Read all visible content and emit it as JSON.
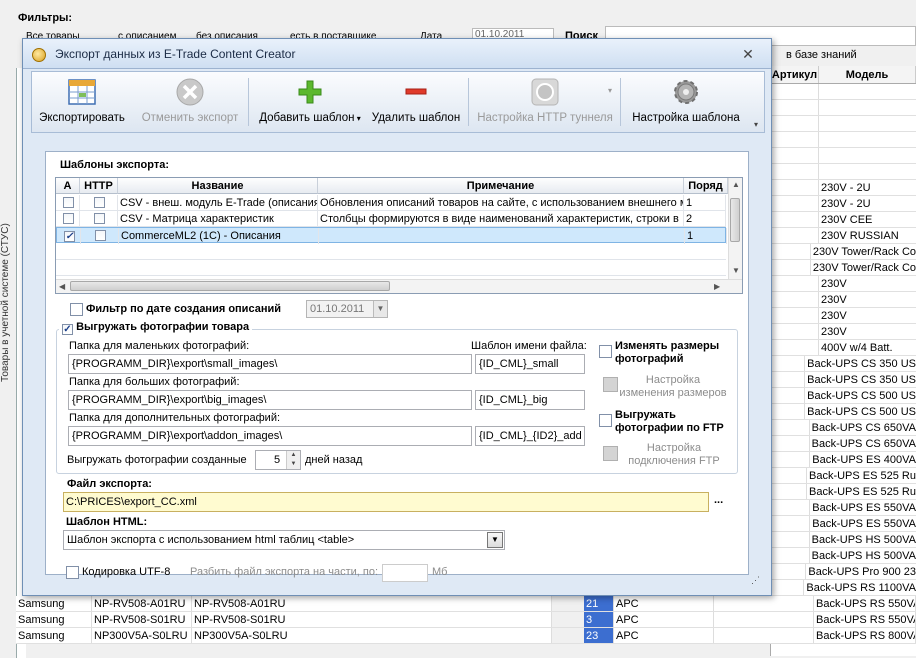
{
  "bg": {
    "filters_label": "Фильтры:",
    "filter_opt1": "Все товары",
    "filter_opt2": "с описанием",
    "filter_opt3": "без описания",
    "filter_opt4": "есть в поставщике",
    "date_label": "Дата",
    "date_value": "01.10.2011",
    "search_label": "Поиск",
    "kb_label": "в базе знаний",
    "vertical_label": "Товары в учетной системе (СТУС)",
    "right_headers": [
      "Артикул",
      "Модель"
    ],
    "right_rows": [
      "",
      "",
      "",
      "",
      "",
      "",
      "230V - 2U",
      "230V - 2U",
      "230V CEE",
      "230V RUSSIAN",
      "230V Tower/Rack Co",
      "230V Tower/Rack Co",
      "230V",
      "230V",
      "230V",
      "230V",
      "400V w/4 Batt.",
      "Back-UPS CS 350 US",
      "Back-UPS CS 350 US",
      "Back-UPS CS 500 US",
      "Back-UPS CS 500 US",
      "Back-UPS CS 650VA",
      "Back-UPS CS 650VA",
      "Back-UPS ES 400VA",
      "Back-UPS ES 525 Ru",
      "Back-UPS ES 525 Ru",
      "Back-UPS ES 550VA",
      "Back-UPS ES 550VA",
      "Back-UPS HS 500VA",
      "Back-UPS HS 500VA",
      "Back-UPS Pro 900 23",
      "Back-UPS RS 1100VA",
      "Back-UPS RS 1100VA",
      "Back-UPS RS 550VA",
      "Back-UPS RS 550VA",
      "Back-UPS RS 800VA"
    ],
    "bottom_rows": [
      {
        "brand": "Samsung",
        "code": "NP-RV508-A01RU",
        "name": "NP-RV508-A01RU",
        "num": "21",
        "vendor": "APC"
      },
      {
        "brand": "Samsung",
        "code": "NP-RV508-S01RU",
        "name": "NP-RV508-S01RU",
        "num": "3",
        "vendor": "APC"
      },
      {
        "brand": "Samsung",
        "code": "NP300V5A-S0LRU",
        "name": "NP300V5A-S0LRU",
        "num": "23",
        "vendor": "APC"
      }
    ]
  },
  "dialog": {
    "title": "Экспорт данных из E-Trade Content Creator",
    "toolbar": {
      "export": "Экспортировать",
      "cancel_export": "Отменить экспорт",
      "add_template": "Добавить шаблон",
      "delete_template": "Удалить шаблон",
      "http_tunnel": "Настройка HTTP туннеля",
      "template_settings": "Настройка шаблона"
    },
    "templates": {
      "label": "Шаблоны экспорта:",
      "headers": [
        "A",
        "HTTP",
        "Название",
        "Примечание",
        "Поряд"
      ],
      "rows": [
        {
          "a": "",
          "http": "",
          "name": "CSV - внеш. модуль E-Trade (описания)",
          "note": "Обновления описаний товаров на сайте, с использованием внешнего мо",
          "order": "1"
        },
        {
          "a": "",
          "http": "",
          "name": "CSV - Матрица характеристик",
          "note": "Столбцы формируются в виде наименований характеристик, строки в",
          "order": "2"
        },
        {
          "a": "✓",
          "http": "",
          "name": "CommerceML2 (1C) - Описания",
          "note": "",
          "order": "1"
        }
      ]
    },
    "date_filter_label": "Фильтр по дате создания описаний",
    "date_filter_value": "01.10.2011",
    "photos": {
      "label": "Выгружать фотографии товара",
      "check": "✓",
      "small_label": "Папка для маленьких фотографий:",
      "small_path": "{PROGRAMM_DIR}\\export\\small_images\\",
      "small_tpl": "{ID_CML}_small",
      "tpl_label": "Шаблон имени файла:",
      "big_label": "Папка для больших фотографий:",
      "big_path": "{PROGRAMM_DIR}\\export\\big_images\\",
      "big_tpl": "{ID_CML}_big",
      "addon_label": "Папка для дополнительных фотографий:",
      "addon_path": "{PROGRAMM_DIR}\\export\\addon_images\\",
      "addon_tpl": "{ID_CML}_{ID2}_add",
      "days_label_pre": "Выгружать фотографии созданные",
      "days_value": "5",
      "days_label_post": "дней назад",
      "resize_label": "Изменять размеры фотографий",
      "resize_settings": "Настройка изменения размеров",
      "ftp_label": "Выгружать фотографии по FTP",
      "ftp_settings": "Настройка подключения FTP"
    },
    "export_file_label": "Файл экспорта:",
    "export_file_value": "C:\\PRICES\\export_CC.xml",
    "browse": "...",
    "html_tpl_label": "Шаблон HTML:",
    "html_tpl_value": "Шаблон экспорта с использованием html таблиц <table>",
    "utf8_label": "Кодировка UTF-8",
    "split_label": "Разбить файл экспорта на части, по:",
    "split_unit": "Мб"
  }
}
